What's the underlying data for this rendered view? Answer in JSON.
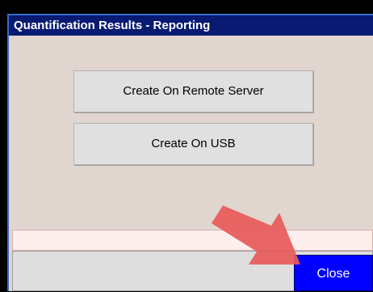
{
  "dialog": {
    "title": "Quantification Results - Reporting"
  },
  "buttons": {
    "remote_label": "Create On Remote Server",
    "usb_label": "Create On USB",
    "close_label": "Close"
  },
  "status": {
    "text": ""
  },
  "colors": {
    "title_bar": "#081a72",
    "dialog_bg": "#e1d5cf",
    "close_button": "#0000ff",
    "arrow": "#e85a5a"
  },
  "icons": {
    "annotation_arrow": "arrow-pointing-to-close"
  }
}
